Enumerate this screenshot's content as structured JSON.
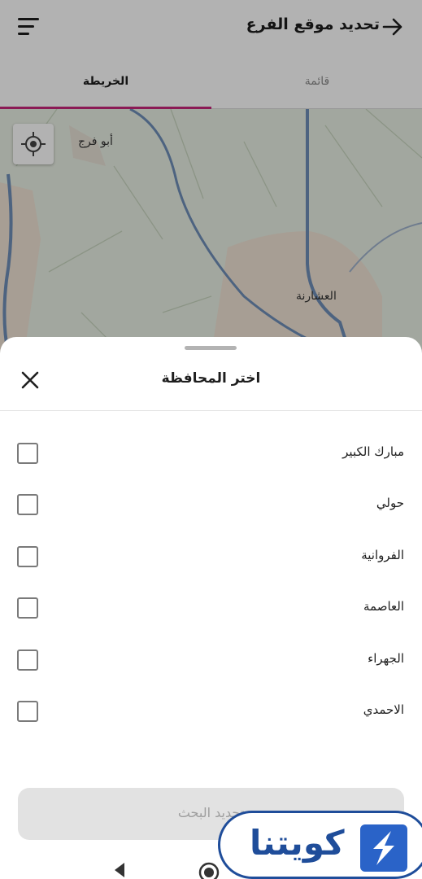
{
  "app_bar": {
    "title": "تحديد موقع الفرع",
    "menu_icon": "hamburger-menu-icon",
    "back_icon": "arrow-right-icon"
  },
  "tabs": [
    {
      "label": "الخريطة",
      "selected": true
    },
    {
      "label": "قائمة",
      "selected": false
    }
  ],
  "colors": {
    "accent": "#c8267a",
    "map_land": "#e9efe4",
    "map_road": "#6f8fb8",
    "map_area": "#f0e4d6",
    "logo_blue": "#1f4d9a"
  },
  "map": {
    "labels": [
      "أبو فرج",
      "العشارنة"
    ],
    "locate_icon": "gps-locate-icon"
  },
  "sheet": {
    "title": "اختر المحافظة",
    "close_icon": "close-icon",
    "options": [
      {
        "label": "مبارك الكبير",
        "checked": false
      },
      {
        "label": "حولي",
        "checked": false
      },
      {
        "label": "الفروانية",
        "checked": false
      },
      {
        "label": "العاصمة",
        "checked": false
      },
      {
        "label": "الجهراء",
        "checked": false
      },
      {
        "label": "الاحمدي",
        "checked": false
      }
    ],
    "search_button": "تحديد البحث"
  },
  "system_nav": {
    "back_icon": "nav-back-triangle-icon",
    "home_icon": "nav-home-circle-icon"
  },
  "logo": {
    "text": "كويتنا",
    "icon": "kuwaitna-logo-icon"
  }
}
